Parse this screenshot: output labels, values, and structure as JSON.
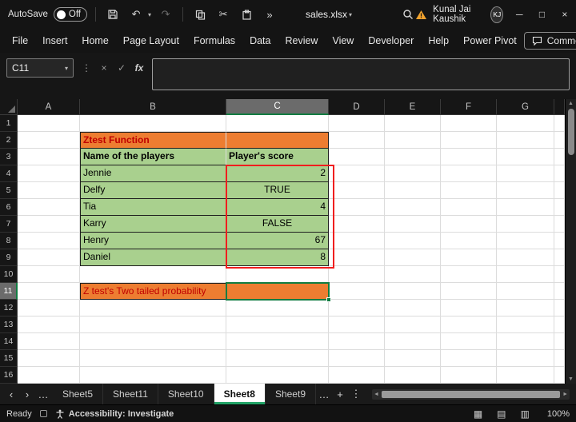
{
  "titlebar": {
    "autosave_label": "AutoSave",
    "autosave_state": "Off",
    "filename": "sales.xlsx",
    "user_name": "Kunal Jai Kaushik",
    "user_initials": "KJ"
  },
  "ribbon": {
    "tabs": [
      "File",
      "Insert",
      "Home",
      "Page Layout",
      "Formulas",
      "Data",
      "Review",
      "View",
      "Developer",
      "Help",
      "Power Pivot"
    ],
    "comments_label": "Comments"
  },
  "formula_bar": {
    "name_box": "C11",
    "formula": "",
    "fx_label": "fx"
  },
  "grid": {
    "columns": [
      "A",
      "B",
      "C",
      "D",
      "E",
      "F",
      "G"
    ],
    "rows": [
      "1",
      "2",
      "3",
      "4",
      "5",
      "6",
      "7",
      "8",
      "9",
      "10",
      "11",
      "12",
      "13",
      "14",
      "15",
      "16"
    ],
    "selected_column": "C",
    "selected_row": "11",
    "selected_cell": "C11"
  },
  "cells": {
    "title": "Ztest Function",
    "header_name": "Name of the players",
    "header_score": "Player's score",
    "players": [
      {
        "name": "Jennie",
        "score": "2",
        "align": "right"
      },
      {
        "name": "Delfy",
        "score": "TRUE",
        "align": "center"
      },
      {
        "name": "Tia",
        "score": "4",
        "align": "right"
      },
      {
        "name": "Karry",
        "score": "FALSE",
        "align": "center"
      },
      {
        "name": "Henry",
        "score": "67",
        "align": "right"
      },
      {
        "name": "Daniel",
        "score": "8",
        "align": "right"
      }
    ],
    "footer_label": "Z test's Two tailed probability"
  },
  "colors": {
    "orange_fill": "#ED7D31",
    "green_fill": "#A9D08E",
    "red_annotation": "#F01E1E",
    "selection_green": "#107C41",
    "accent_green": "#21A366",
    "cell_text_red": "#C00000"
  },
  "sheet_tabs": {
    "tabs": [
      "Sheet5",
      "Sheet11",
      "Sheet10",
      "Sheet8",
      "Sheet9"
    ],
    "active": "Sheet8"
  },
  "status_bar": {
    "ready_label": "Ready",
    "accessibility_label": "Accessibility: Investigate",
    "zoom_level": "100%"
  },
  "icons": {
    "dropdown": "▾",
    "undo": "↶",
    "redo": "↷",
    "cut": "✂",
    "overflow": "»",
    "minimize": "─",
    "maximize": "□",
    "close": "×",
    "cancel": "×",
    "enter": "✓",
    "kebab": "⋮",
    "nav_left": "‹",
    "nav_right": "›",
    "ellipsis": "…",
    "add_sheet": "+",
    "scroll_left": "◄",
    "scroll_right": "►",
    "scroll_up": "▲",
    "scroll_down": "▼",
    "view_normal": "▦",
    "view_layout": "▤",
    "view_break": "▥"
  }
}
